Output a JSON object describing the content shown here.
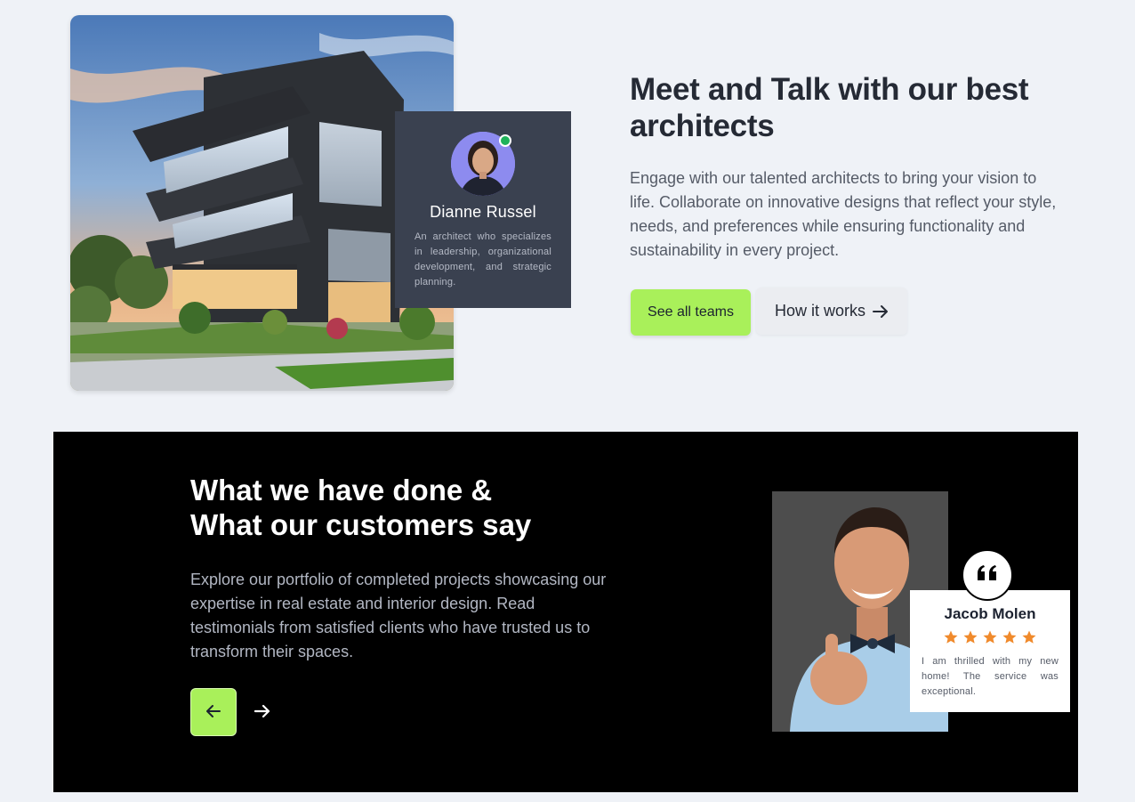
{
  "architects": {
    "featured": {
      "name": "Dianne Russel",
      "description": "An architect who specializes in leadership, organizational development, and strategic planning.",
      "online": true
    },
    "title": "Meet and Talk with our best architects",
    "description": "Engage with our talented architects to bring your vision to life. Collaborate on innovative designs that reflect your style, needs, and preferences while ensuring functionality and sustainability in every project.",
    "see_teams_label": "See all teams",
    "how_it_works_label": "How it works"
  },
  "testimonials": {
    "title_line1": "What we have done &",
    "title_line2": "What our customers say",
    "description": "Explore our portfolio of completed projects showcasing our expertise in real estate and interior design. Read testimonials from satisfied clients who have trusted us to transform their spaces.",
    "review": {
      "name": "Jacob Molen",
      "rating": 5,
      "rating_max": 5,
      "text": "I am thrilled with my new home! The service was exceptional."
    }
  },
  "colors": {
    "accent": "#a9f05a",
    "dark_bg": "#000000",
    "page_bg": "#eff2f7",
    "card_dark": "#3a4150",
    "star": "#f08a2c",
    "online": "#1fb25a"
  },
  "icons": {
    "how_it_works": "arrow-right-icon",
    "prev": "arrow-left-icon",
    "next": "arrow-right-icon",
    "quote": "quote-icon",
    "star": "star-icon"
  }
}
